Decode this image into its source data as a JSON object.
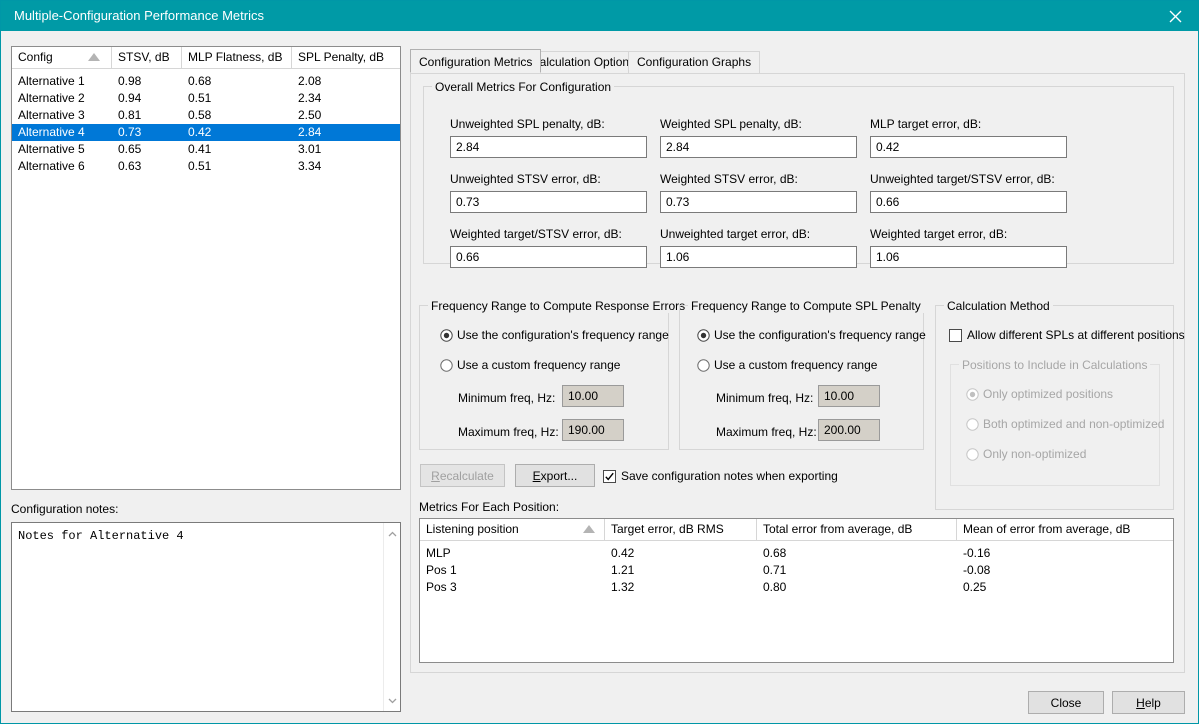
{
  "window": {
    "title": "Multiple-Configuration Performance Metrics",
    "close_icon": "close-icon",
    "titlebar_color": "#009aa6",
    "selection_color": "#0078d7"
  },
  "config_list": {
    "columns": [
      "Config",
      "STSV, dB",
      "MLP Flatness, dB",
      "SPL Penalty, dB"
    ],
    "sort_column": "Config",
    "sort_direction": "ascending",
    "rows": [
      {
        "config": "Alternative 1",
        "stsv": "0.98",
        "mlp_flatness": "0.68",
        "spl_penalty": "2.08",
        "selected": false
      },
      {
        "config": "Alternative 2",
        "stsv": "0.94",
        "mlp_flatness": "0.51",
        "spl_penalty": "2.34",
        "selected": false
      },
      {
        "config": "Alternative 3",
        "stsv": "0.81",
        "mlp_flatness": "0.58",
        "spl_penalty": "2.50",
        "selected": false
      },
      {
        "config": "Alternative 4",
        "stsv": "0.73",
        "mlp_flatness": "0.42",
        "spl_penalty": "2.84",
        "selected": true
      },
      {
        "config": "Alternative 5",
        "stsv": "0.65",
        "mlp_flatness": "0.41",
        "spl_penalty": "3.01",
        "selected": false
      },
      {
        "config": "Alternative 6",
        "stsv": "0.63",
        "mlp_flatness": "0.51",
        "spl_penalty": "3.34",
        "selected": false
      }
    ]
  },
  "notes": {
    "label": "Configuration notes:",
    "value": "Notes for Alternative 4",
    "scroll_up_icon": "chevron-up-icon",
    "scroll_down_icon": "chevron-down-icon"
  },
  "tabs": [
    {
      "label": "Configuration Metrics",
      "active": true
    },
    {
      "label": "Calculation Options",
      "active": false
    },
    {
      "label": "Configuration Graphs",
      "active": false
    }
  ],
  "overall_metrics": {
    "title": "Overall Metrics For Configuration",
    "fields": [
      {
        "label": "Unweighted SPL penalty, dB:",
        "value": "2.84"
      },
      {
        "label": "Weighted SPL penalty, dB:",
        "value": "2.84"
      },
      {
        "label": "MLP target error, dB:",
        "value": "0.42"
      },
      {
        "label": "Unweighted STSV error, dB:",
        "value": "0.73"
      },
      {
        "label": "Weighted STSV error, dB:",
        "value": "0.73"
      },
      {
        "label": "Unweighted target/STSV error, dB:",
        "value": "0.66"
      },
      {
        "label": "Weighted target/STSV error, dB:",
        "value": "0.66"
      },
      {
        "label": "Unweighted target error, dB:",
        "value": "1.06"
      },
      {
        "label": "Weighted target error, dB:",
        "value": "1.06"
      }
    ]
  },
  "response_errors_group": {
    "title": "Frequency Range to Compute Response Errors",
    "option_config_range": "Use the configuration's frequency range",
    "option_custom_range": "Use a custom frequency range",
    "selected": "config_range",
    "min_label": "Minimum freq, Hz:",
    "min_value": "10.00",
    "max_label": "Maximum freq, Hz:",
    "max_value": "190.00",
    "fields_enabled": false
  },
  "spl_penalty_group": {
    "title": "Frequency Range to Compute SPL Penalty",
    "option_config_range": "Use the configuration's frequency range",
    "option_custom_range": "Use a custom frequency range",
    "selected": "config_range",
    "min_label": "Minimum freq, Hz:",
    "min_value": "10.00",
    "max_label": "Maximum freq, Hz:",
    "max_value": "200.00",
    "fields_enabled": false
  },
  "calculation_method": {
    "title": "Calculation Method",
    "allow_different_spls_label": "Allow different SPLs at different positions",
    "allow_different_spls_checked": false,
    "positions_group_title": "Positions to Include in Calculations",
    "positions_enabled": false,
    "positions_options": [
      {
        "label": "Only optimized positions",
        "selected": true
      },
      {
        "label": "Both optimized and non-optimized",
        "selected": false
      },
      {
        "label": "Only non-optimized",
        "selected": false
      }
    ]
  },
  "actions": {
    "recalculate_label": "Recalculate",
    "recalculate_mnemonic": "R",
    "recalculate_enabled": false,
    "export_label": "Export...",
    "export_mnemonic": "E",
    "save_notes_label": "Save configuration notes when exporting",
    "save_notes_checked": true
  },
  "positions_table": {
    "caption": "Metrics For Each Position:",
    "columns": [
      "Listening position",
      "Target error, dB RMS",
      "Total error from average, dB",
      "Mean of error from average, dB"
    ],
    "sort_column": "Listening position",
    "sort_direction": "ascending",
    "rows": [
      {
        "position": "MLP",
        "target_error": "0.42",
        "total_error": "0.68",
        "mean_error": "-0.16"
      },
      {
        "position": "Pos 1",
        "target_error": "1.21",
        "total_error": "0.71",
        "mean_error": "-0.08"
      },
      {
        "position": "Pos 3",
        "target_error": "1.32",
        "total_error": "0.80",
        "mean_error": "0.25"
      }
    ]
  },
  "footer": {
    "close_label": "Close",
    "help_label": "Help",
    "help_mnemonic": "H"
  }
}
